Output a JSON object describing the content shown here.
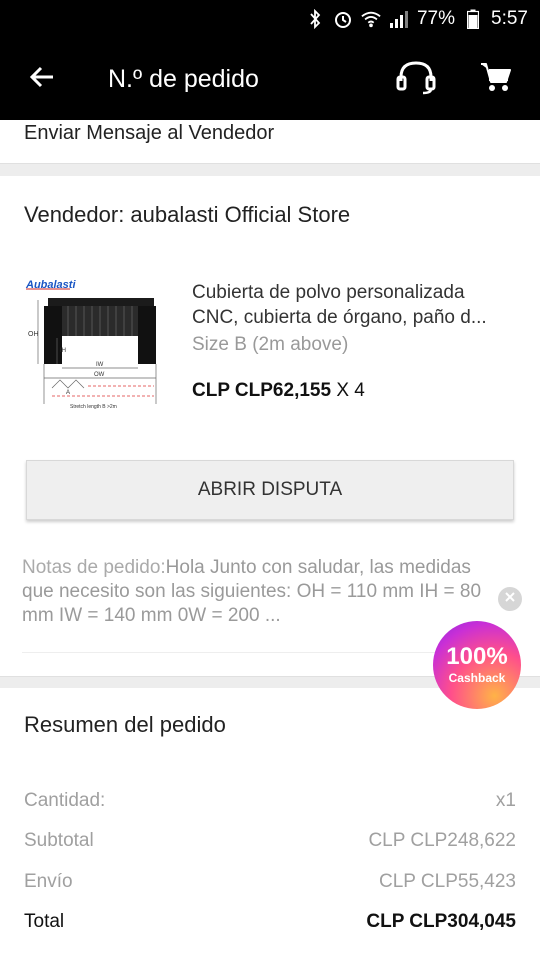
{
  "status_bar": {
    "battery": "77%",
    "time": "5:57"
  },
  "header": {
    "title": "N.º de pedido"
  },
  "message_row": {
    "label": "Enviar Mensaje al Vendedor"
  },
  "vendor": {
    "title": "Vendedor: aubalasti Official Store"
  },
  "product": {
    "name": "Cubierta de polvo personalizada CNC, cubierta de órgano, paño d...",
    "variant": "Size B (2m above)",
    "price": "CLP CLP62,155",
    "quantity": "X 4",
    "image_brand": "Aubalasti",
    "image_labels": [
      "OH",
      "IH",
      "IW",
      "OW",
      "A",
      "Stretch length B >2m"
    ]
  },
  "dispute_button": {
    "label": "ABRIR DISPUTA"
  },
  "notes": {
    "label": "Notas de pedido:",
    "text": "Hola Junto con saludar, las medidas que necesito son las siguientes: OH = 110 mm IH = 80 mm IW = 140 mm 0W = 200 ..."
  },
  "cashback": {
    "percent": "100%",
    "label": "Cashback"
  },
  "summary": {
    "title": "Resumen del pedido",
    "rows": [
      {
        "label": "Cantidad:",
        "value": "x1"
      },
      {
        "label": "Subtotal",
        "value": "CLP CLP248,622"
      },
      {
        "label": "Envío",
        "value": "CLP CLP55,423"
      },
      {
        "label": "Total",
        "value": "CLP CLP304,045"
      }
    ]
  },
  "icons": {
    "back": "arrow-back-icon",
    "support": "headset-icon",
    "cart": "cart-icon",
    "close": "close-icon"
  },
  "colors": {
    "header_bg": "#000000",
    "cashback_accent": "#ff4f8b"
  }
}
